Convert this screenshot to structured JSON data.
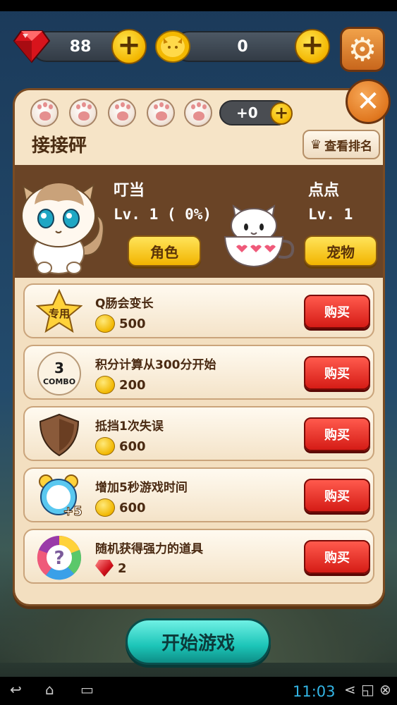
{
  "currency": {
    "gems": "88",
    "coins": "0"
  },
  "panel": {
    "paw_count": "+0",
    "title": "接接砰",
    "rank_button": "查看排名"
  },
  "character": {
    "name": "叮当",
    "level": "Lv. 1 (  0%)",
    "button": "角色"
  },
  "pet": {
    "name": "点点",
    "level": "Lv. 1",
    "button": "宠物"
  },
  "items": [
    {
      "name": "Q肠会变长",
      "price": "500",
      "currency": "coin",
      "icon_label": "专用",
      "buy": "购买"
    },
    {
      "name": "积分计算从300分开始",
      "price": "200",
      "currency": "coin",
      "icon_label": "3",
      "icon_label2": "COMBO",
      "buy": "购买"
    },
    {
      "name": "抵挡1次失误",
      "price": "600",
      "currency": "coin",
      "icon_label": "",
      "buy": "购买"
    },
    {
      "name": "增加5秒游戏时间",
      "price": "600",
      "currency": "coin",
      "icon_label": "+5",
      "buy": "购买"
    },
    {
      "name": "随机获得强力的道具",
      "price": "2",
      "currency": "gem",
      "icon_label": "?",
      "buy": "购买"
    }
  ],
  "start_button": "开始游戏",
  "system": {
    "clock": "11:03"
  },
  "colors": {
    "buy": "#d51c16",
    "start": "#1cc5b8",
    "accent": "#f2b400",
    "panel": "#f3dfc0"
  }
}
